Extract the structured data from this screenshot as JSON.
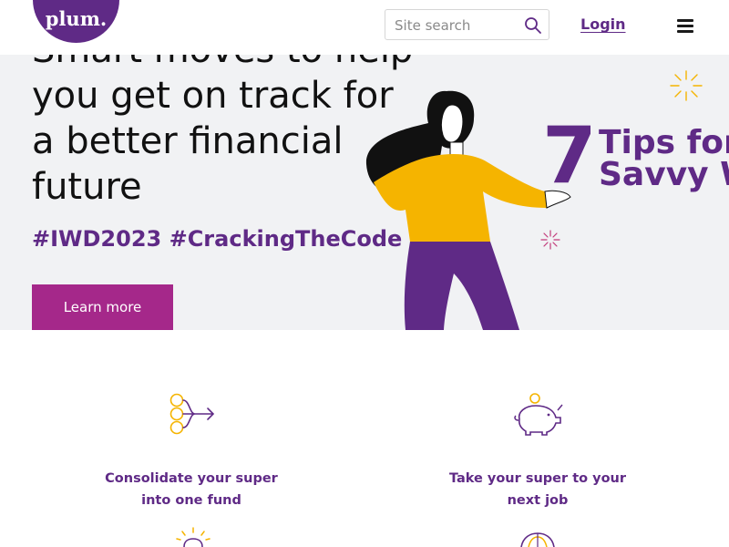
{
  "header": {
    "logo_text": "plum.",
    "search_placeholder": "Site search",
    "login_label": "Login"
  },
  "hero": {
    "title": "Smart moves to help you get on track for a better financial future",
    "tags": "#IWD2023 #CrackingTheCode",
    "cta_label": "Learn more",
    "graphic_number": "7",
    "graphic_line1": "Tips for",
    "graphic_line2": "Savvy W"
  },
  "features": [
    {
      "label": "Consolidate your super into one fund",
      "icon": "consolidate-icon"
    },
    {
      "label": "Take your super to your next job",
      "icon": "piggy-bank-icon"
    }
  ],
  "colors": {
    "brand_purple": "#5f2a86",
    "cta_magenta": "#a5288a",
    "accent_gold": "#f5b400",
    "hero_bg": "#f1f2f4"
  }
}
